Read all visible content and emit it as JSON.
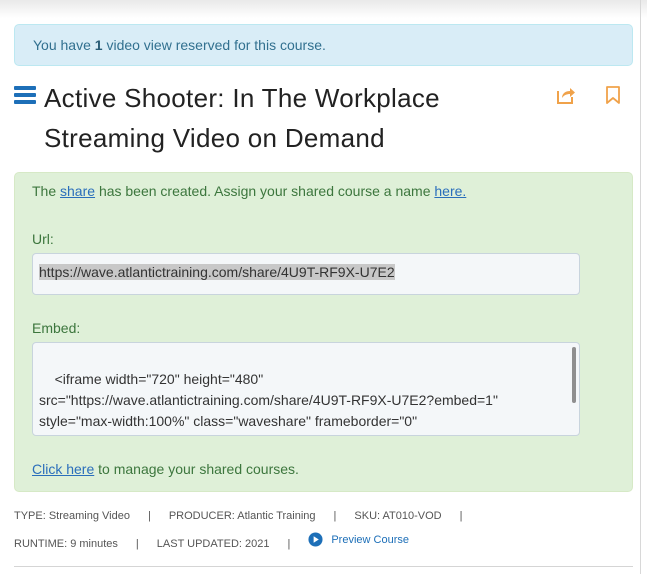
{
  "notice": {
    "prefix": "You have",
    "count": "1",
    "suffix": "video view reserved for this course."
  },
  "course": {
    "title_line1": "Active Shooter: In The Workplace",
    "title_line2": "Streaming Video on Demand"
  },
  "icons": {
    "menu": "hamburger-menu-icon",
    "share": "share-icon",
    "bookmark": "bookmark-icon",
    "play": "play-circle-icon"
  },
  "share_panel": {
    "msg_prefix": "The",
    "share_link": "share",
    "msg_middle": "has been created. Assign your shared course a name",
    "here_link": "here.",
    "url_label": "Url:",
    "url_value": "https://wave.atlantictraining.com/share/4U9T-RF9X-U7E2",
    "embed_label": "Embed:",
    "embed_value": "<iframe width=\"720\" height=\"480\"\nsrc=\"https://wave.atlantictraining.com/share/4U9T-RF9X-U7E2?embed=1\"\nstyle=\"max-width:100%\" class=\"waveshare\" frameborder=\"0\"\nallow=\"accelerometer; autoplay; encrypted-media; gyroscope; picture-in-\npicture\" allowfullscreen></iframe>",
    "manage_link": "Click here",
    "manage_suffix": "to manage your shared courses."
  },
  "meta": {
    "type": "TYPE: Streaming Video",
    "producer": "PRODUCER: Atlantic Training",
    "sku": "SKU: AT010-VOD",
    "runtime": "RUNTIME: 9 minutes",
    "last_updated": "LAST UPDATED: 2021",
    "preview": "Preview Course",
    "separator": "|"
  },
  "colors": {
    "accent": "#1d6fb8",
    "orange": "#f0a24a",
    "info_bg": "#d9edf7",
    "success_bg": "#dff0d8"
  }
}
